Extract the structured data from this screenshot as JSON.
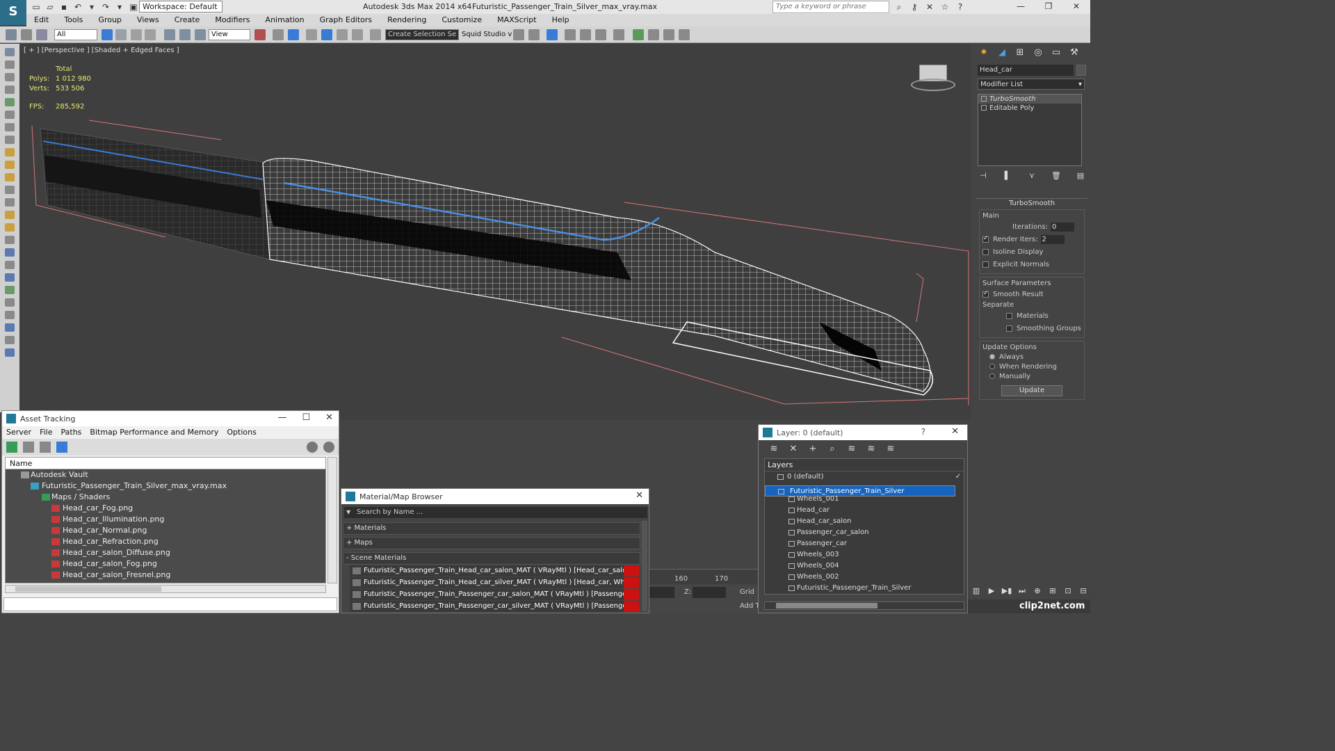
{
  "app": {
    "logo_text": "S",
    "workspace": "Workspace: Default",
    "title": "Autodesk 3ds Max  2014 x64",
    "file": "Futuristic_Passenger_Train_Silver_max_vray.max",
    "search_placeholder": "Type a keyword or phrase"
  },
  "menu": [
    "Edit",
    "Tools",
    "Group",
    "Views",
    "Create",
    "Modifiers",
    "Animation",
    "Graph Editors",
    "Rendering",
    "Customize",
    "MAXScript",
    "Help"
  ],
  "toolbar": {
    "filter": "All",
    "ref_coord": "View",
    "selection_set": "Create Selection Se",
    "squid": "Squid Studio v"
  },
  "viewport": {
    "label": "[ + ] [Perspective ] [Shaded + Edged Faces ]",
    "total_label": "Total",
    "polys_label": "Polys:",
    "polys": "1 012 980",
    "verts_label": "Verts:",
    "verts": "533 506",
    "fps_label": "FPS:",
    "fps": "285,592"
  },
  "command_panel": {
    "object_name": "Head_car",
    "modifier_list": "Modifier List",
    "stack": [
      "TurboSmooth",
      "Editable Poly"
    ],
    "turbosmooth": {
      "title": "TurboSmooth",
      "main_label": "Main",
      "iterations_label": "Iterations:",
      "iterations": "0",
      "render_iters_label": "Render Iters:",
      "render_iters": "2",
      "isoline": "Isoline Display",
      "explicit_normals": "Explicit Normals",
      "surface_params": "Surface Parameters",
      "smooth_result": "Smooth Result",
      "separate": "Separate",
      "materials": "Materials",
      "smoothing_groups": "Smoothing Groups",
      "update_options": "Update Options",
      "always": "Always",
      "when_rendering": "When Rendering",
      "manually": "Manually",
      "update": "Update"
    }
  },
  "asset_tracking": {
    "title": "Asset Tracking",
    "menu": [
      "Server",
      "File",
      "Paths",
      "Bitmap Performance and Memory",
      "Options"
    ],
    "column_name": "Name",
    "rows": [
      {
        "label": "Autodesk Vault",
        "indent": 1
      },
      {
        "label": "Futuristic_Passenger_Train_Silver_max_vray.max",
        "indent": 2
      },
      {
        "label": "Maps / Shaders",
        "indent": 3
      },
      {
        "label": "Head_car_Fog.png",
        "indent": 4
      },
      {
        "label": "Head_car_Illumination.png",
        "indent": 4
      },
      {
        "label": "Head_car_Normal.png",
        "indent": 4
      },
      {
        "label": "Head_car_Refraction.png",
        "indent": 4
      },
      {
        "label": "Head_car_salon_Diffuse.png",
        "indent": 4
      },
      {
        "label": "Head_car_salon_Fog.png",
        "indent": 4
      },
      {
        "label": "Head_car_salon_Fresnel.png",
        "indent": 4
      }
    ]
  },
  "material_browser": {
    "title": "Material/Map Browser",
    "search": "Search by Name ...",
    "categories": [
      "+ Materials",
      "+ Maps",
      "- Scene Materials"
    ],
    "items": [
      "Futuristic_Passenger_Train_Head_car_salon_MAT ( VRayMtl ) [Head_car_salon]",
      "Futuristic_Passenger_Train_Head_car_silver_MAT ( VRayMtl ) [Head_car, Whee...",
      "Futuristic_Passenger_Train_Passenger_car_salon_MAT ( VRayMtl ) [Passenger_...",
      "Futuristic_Passenger_Train_Passenger_car_silver_MAT ( VRayMtl ) [Passenger_..."
    ]
  },
  "layer_panel": {
    "title": "Layer: 0 (default)",
    "help": "?",
    "header": "Layers",
    "rows": [
      {
        "label": "0 (default)",
        "level": 0
      },
      {
        "label": "Futuristic_Passenger_Train_Silver",
        "level": 0
      },
      {
        "label": "Wheels_001",
        "level": 1
      },
      {
        "label": "Head_car",
        "level": 1
      },
      {
        "label": "Head_car_salon",
        "level": 1
      },
      {
        "label": "Passenger_car_salon",
        "level": 1
      },
      {
        "label": "Passenger_car",
        "level": 1
      },
      {
        "label": "Wheels_003",
        "level": 1
      },
      {
        "label": "Wheels_004",
        "level": 1
      },
      {
        "label": "Wheels_002",
        "level": 1
      },
      {
        "label": "Futuristic_Passenger_Train_Silver",
        "level": 1
      }
    ]
  },
  "timeline": {
    "ticks": [
      "160",
      "170"
    ],
    "z_label": "Z:",
    "grid_label": "Grid",
    "add_time_tag": "Add T"
  },
  "watermark": "clip2net.com",
  "colors": {
    "selection": "#1565c0",
    "material_flag": "#cc1111",
    "stats_text": "#e8e870",
    "bbox_lines": "#d8767a"
  }
}
